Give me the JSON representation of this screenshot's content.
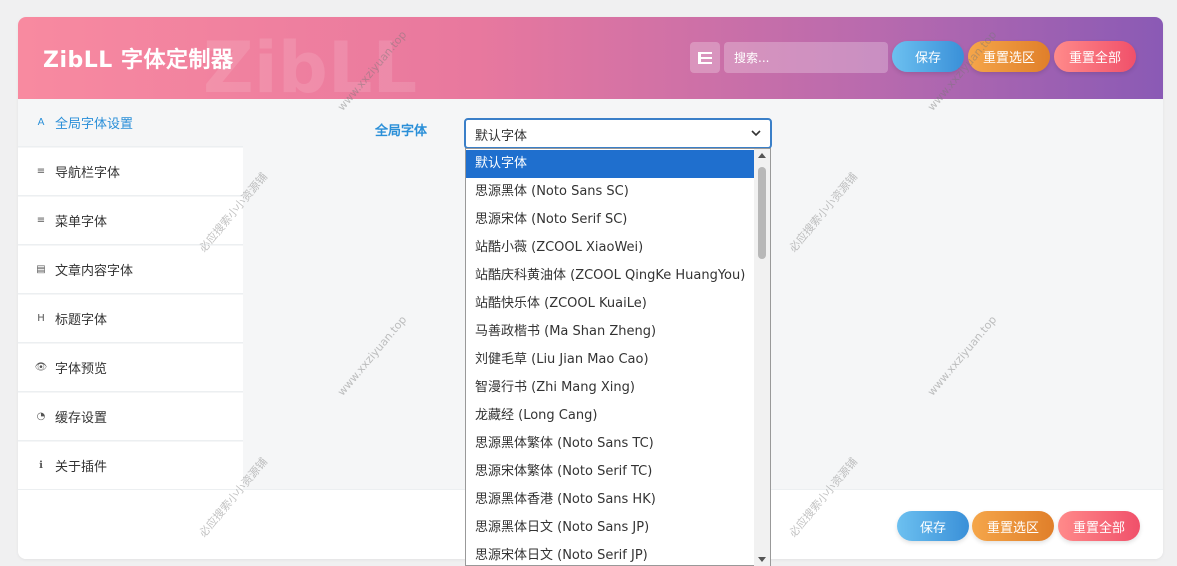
{
  "header": {
    "title": "ZibLL 字体定制器",
    "search_placeholder": "搜索...",
    "save_label": "保存",
    "reset_selection_label": "重置选区",
    "reset_all_label": "重置全部"
  },
  "sidebar": {
    "items": [
      {
        "label": "全局字体设置",
        "icon": "A",
        "icon_name": "font-a-icon",
        "active": true
      },
      {
        "label": "导航栏字体",
        "icon": "≡",
        "icon_name": "bars-icon",
        "active": false
      },
      {
        "label": "菜单字体",
        "icon": "≡",
        "icon_name": "menu-icon",
        "active": false
      },
      {
        "label": "文章内容字体",
        "icon": "▤",
        "icon_name": "document-icon",
        "active": false
      },
      {
        "label": "标题字体",
        "icon": "H",
        "icon_name": "heading-icon",
        "active": false
      },
      {
        "label": "字体预览",
        "icon": "👁",
        "icon_name": "eye-icon",
        "active": false
      },
      {
        "label": "缓存设置",
        "icon": "◔",
        "icon_name": "gauge-icon",
        "active": false
      },
      {
        "label": "关于插件",
        "icon": "ℹ",
        "icon_name": "info-icon",
        "active": false
      }
    ]
  },
  "main": {
    "field_label": "全局字体",
    "select_value": "默认字体",
    "options": [
      "默认字体",
      "思源黑体 (Noto Sans SC)",
      "思源宋体 (Noto Serif SC)",
      "站酷小薇 (ZCOOL XiaoWei)",
      "站酷庆科黄油体 (ZCOOL QingKe HuangYou)",
      "站酷快乐体 (ZCOOL KuaiLe)",
      "马善政楷书 (Ma Shan Zheng)",
      "刘健毛草 (Liu Jian Mao Cao)",
      "智漫行书 (Zhi Mang Xing)",
      "龙藏经 (Long Cang)",
      "思源黑体繁体 (Noto Sans TC)",
      "思源宋体繁体 (Noto Serif TC)",
      "思源黑体香港 (Noto Sans HK)",
      "思源黑体日文 (Noto Sans JP)",
      "思源宋体日文 (Noto Serif JP)"
    ]
  },
  "footer": {
    "save_label": "保存",
    "reset_selection_label": "重置选区",
    "reset_all_label": "重置全部"
  },
  "watermarks": {
    "site": "www.xxziyuan.top",
    "cn": "必应搜索小小资源铺"
  },
  "colors": {
    "accent": "#2a8fd8",
    "selected_option": "#1f6fce"
  }
}
